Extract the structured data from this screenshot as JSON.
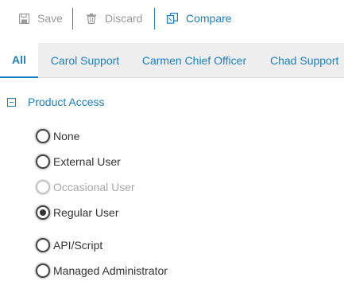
{
  "toolbar": {
    "save_label": "Save",
    "discard_label": "Discard",
    "compare_label": "Compare"
  },
  "tabs": [
    {
      "label": "All",
      "selected": true
    },
    {
      "label": "Carol Support"
    },
    {
      "label": "Carmen Chief Officer"
    },
    {
      "label": "Chad Support"
    }
  ],
  "section": {
    "title": "Product Access",
    "expanded": true
  },
  "options": [
    {
      "label": "None",
      "checked": false,
      "disabled": false
    },
    {
      "label": "External User",
      "checked": false,
      "disabled": false
    },
    {
      "label": "Occasional User",
      "checked": false,
      "disabled": true
    },
    {
      "label": "Regular User",
      "checked": true,
      "disabled": false
    },
    {
      "label": "API/Script",
      "checked": false,
      "disabled": false
    },
    {
      "label": "Managed Administrator",
      "checked": false,
      "disabled": false
    }
  ],
  "colors": {
    "accent": "#1b7fc1",
    "disabled_text": "#a9a9a9",
    "tabbar_bg": "#eeeeee"
  },
  "icons": {
    "save": "floppy-disk-icon",
    "discard": "trash-icon",
    "compare": "compare-icon",
    "section": "collapse-icon"
  }
}
